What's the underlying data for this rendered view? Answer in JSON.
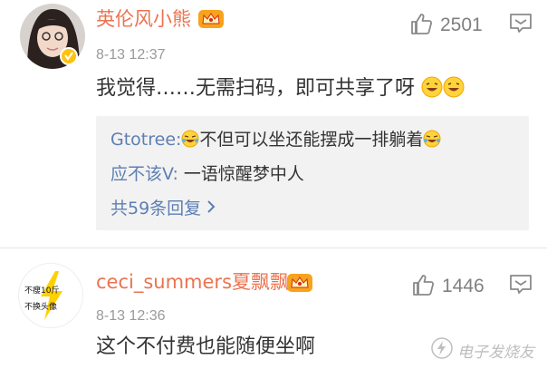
{
  "comments": [
    {
      "username": "英伦风小熊",
      "time": "8-13 12:37",
      "likes": "2501",
      "content": "我觉得……无需扫码，即可共享了呀",
      "replies": [
        {
          "user": "Gtotree:",
          "text": "不但可以坐还能摆成一排躺着"
        },
        {
          "user": "应不该V:",
          "text": " 一语惊醒梦中人"
        }
      ],
      "more_replies": "共59条回复"
    },
    {
      "username": "ceci_summers夏飘飘",
      "time": "8-13 12:36",
      "likes": "1446",
      "content": "这个不付费也能随便坐啊",
      "avatar_text": [
        "不瘦10斤",
        "不换头像"
      ]
    }
  ],
  "watermark": "电子发烧友",
  "colors": {
    "username": "#eb7350",
    "link": "#5d7fb3",
    "reply_bg": "#f2f2f2",
    "muted": "#9a9a9a"
  }
}
